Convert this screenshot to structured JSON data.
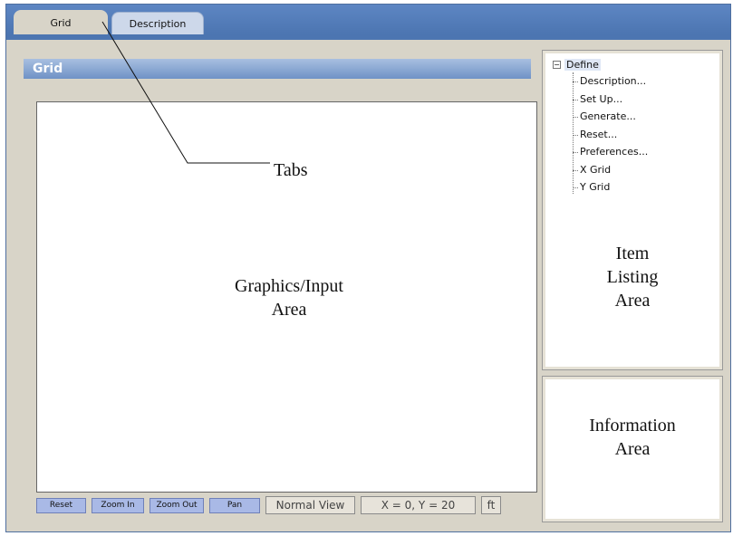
{
  "tabs": [
    {
      "label": "Grid"
    },
    {
      "label": "Description"
    }
  ],
  "panel": {
    "header": "Grid"
  },
  "graphics_area": {
    "label_line1": "Graphics/Input",
    "label_line2": "Area"
  },
  "annotations": {
    "tabs": "Tabs",
    "item_listing_line1": "Item",
    "item_listing_line2": "Listing",
    "item_listing_line3": "Area",
    "information_line1": "Information",
    "information_line2": "Area"
  },
  "tree": {
    "root": "Define",
    "items": [
      "Description...",
      "Set Up...",
      "Generate...",
      "Reset...",
      "Preferences...",
      "X Grid",
      "Y Grid"
    ]
  },
  "statusbar": {
    "buttons": [
      "Reset",
      "Zoom In",
      "Zoom Out",
      "Pan"
    ],
    "view": "Normal View",
    "coords": "X = 0, Y = 20",
    "unit": "ft"
  }
}
